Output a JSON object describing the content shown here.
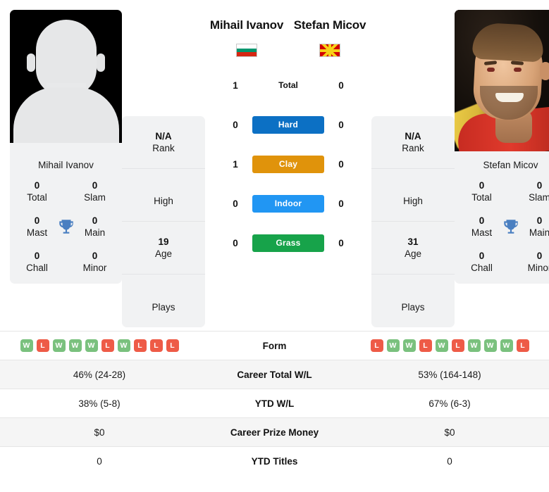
{
  "players": {
    "left": {
      "name": "Mihail Ivanov",
      "photo_caption": "Mihail Ivanov",
      "photo_type": "placeholder-silhouette",
      "flag": "Bulgaria",
      "rank_value": "N/A",
      "rank_label": "Rank",
      "high_value": "",
      "high_label": "High",
      "age_value": "19",
      "age_label": "Age",
      "plays_value": "",
      "plays_label": "Plays",
      "titles": {
        "total_value": "0",
        "total_label": "Total",
        "slam_value": "0",
        "slam_label": "Slam",
        "mast_value": "0",
        "mast_label": "Mast",
        "main_value": "0",
        "main_label": "Main",
        "chall_value": "0",
        "chall_label": "Chall",
        "minor_value": "0",
        "minor_label": "Minor"
      },
      "form": [
        "W",
        "L",
        "W",
        "W",
        "W",
        "L",
        "W",
        "L",
        "L",
        "L"
      ],
      "career_wl": "46% (24-28)",
      "ytd_wl": "38% (5-8)",
      "career_prize": "$0",
      "ytd_titles": "0"
    },
    "right": {
      "name": "Stefan Micov",
      "photo_caption": "Stefan Micov",
      "photo_type": "photograph",
      "flag": "North Macedonia",
      "rank_value": "N/A",
      "rank_label": "Rank",
      "high_value": "",
      "high_label": "High",
      "age_value": "31",
      "age_label": "Age",
      "plays_value": "",
      "plays_label": "Plays",
      "titles": {
        "total_value": "0",
        "total_label": "Total",
        "slam_value": "0",
        "slam_label": "Slam",
        "mast_value": "0",
        "mast_label": "Mast",
        "main_value": "0",
        "main_label": "Main",
        "chall_value": "0",
        "chall_label": "Chall",
        "minor_value": "0",
        "minor_label": "Minor"
      },
      "form": [
        "L",
        "W",
        "W",
        "L",
        "W",
        "L",
        "W",
        "W",
        "W",
        "L"
      ],
      "career_wl": "53% (164-148)",
      "ytd_wl": "67% (6-3)",
      "career_prize": "$0",
      "ytd_titles": "0"
    }
  },
  "h2h": {
    "rows": [
      {
        "label": "Total",
        "left": "1",
        "right": "0",
        "style": "plain",
        "color": ""
      },
      {
        "label": "Hard",
        "left": "0",
        "right": "0",
        "style": "badge",
        "color": "#0c70c4"
      },
      {
        "label": "Clay",
        "left": "1",
        "right": "0",
        "style": "badge",
        "color": "#e0930b"
      },
      {
        "label": "Indoor",
        "left": "0",
        "right": "0",
        "style": "badge",
        "color": "#2196f3"
      },
      {
        "label": "Grass",
        "left": "0",
        "right": "0",
        "style": "badge",
        "color": "#17a34a"
      }
    ]
  },
  "table": {
    "rows": [
      {
        "label": "Form",
        "type": "form"
      },
      {
        "label": "Career Total W/L",
        "type": "text",
        "key": "career_wl"
      },
      {
        "label": "YTD W/L",
        "type": "text",
        "key": "ytd_wl"
      },
      {
        "label": "Career Prize Money",
        "type": "text",
        "key": "career_prize"
      },
      {
        "label": "YTD Titles",
        "type": "text",
        "key": "ytd_titles"
      }
    ]
  },
  "colors": {
    "trophy": "#4a7fc1",
    "win": "#7ac17e",
    "loss": "#ee5b47",
    "card_bg": "#f1f2f3",
    "alt_row": "#f5f5f5"
  },
  "icons": {
    "trophy": "trophy-icon",
    "flag_left": "flag-bulgaria-icon",
    "flag_right": "flag-north-macedonia-icon"
  }
}
